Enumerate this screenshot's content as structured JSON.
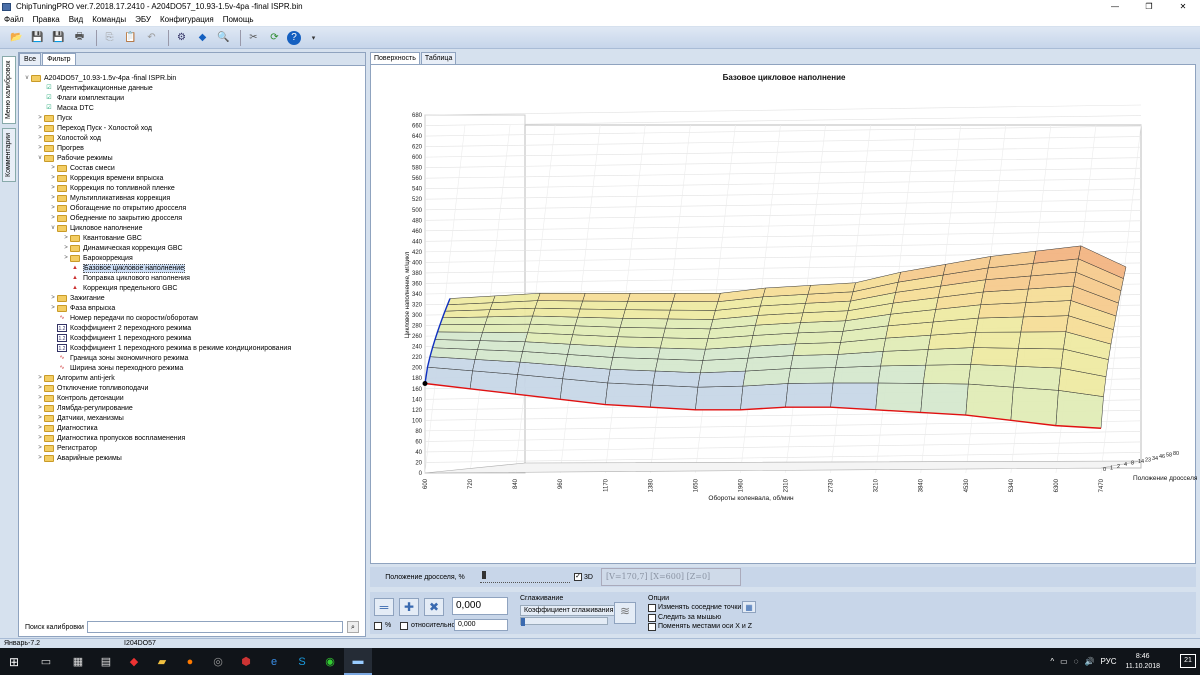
{
  "window": {
    "title": "ChipTuningPRO ver.7.2018.17.2410 - A204DO57_10.93-1.5v-4pa -final ISPR.bin",
    "min": "—",
    "max": "❐",
    "close": "✕"
  },
  "menu": [
    "Файл",
    "Правка",
    "Вид",
    "Команды",
    "ЭБУ",
    "Конфигурация",
    "Помощь"
  ],
  "side_tabs": {
    "calib": "Меню калибровок",
    "comments": "Комментарии"
  },
  "left": {
    "tabs": [
      "Все",
      "Фильтр"
    ],
    "tree": [
      {
        "label": "A204DO57_10.93-1.5v-4pa -final ISPR.bin",
        "level": 0,
        "icon": "folder",
        "toggle": "v"
      },
      {
        "label": "Идентификационные данные",
        "level": 1,
        "icon": "check",
        "toggle": ""
      },
      {
        "label": "Флаги комплектации",
        "level": 1,
        "icon": "check",
        "toggle": ""
      },
      {
        "label": "Маска DTC",
        "level": 1,
        "icon": "check",
        "toggle": ""
      },
      {
        "label": "Пуск",
        "level": 1,
        "icon": "folder",
        "toggle": ">"
      },
      {
        "label": "Переход Пуск - Холостой ход",
        "level": 1,
        "icon": "folder",
        "toggle": ">"
      },
      {
        "label": "Холостой ход",
        "level": 1,
        "icon": "folder",
        "toggle": ">"
      },
      {
        "label": "Прогрев",
        "level": 1,
        "icon": "folder",
        "toggle": ">"
      },
      {
        "label": "Рабочие режимы",
        "level": 1,
        "icon": "folder",
        "toggle": "v"
      },
      {
        "label": "Состав смеси",
        "level": 2,
        "icon": "folder",
        "toggle": ">"
      },
      {
        "label": "Коррекция времени впрыска",
        "level": 2,
        "icon": "folder",
        "toggle": ">"
      },
      {
        "label": "Коррекция по топливной пленке",
        "level": 2,
        "icon": "folder",
        "toggle": ">"
      },
      {
        "label": "Мультипликативная коррекция",
        "level": 2,
        "icon": "folder",
        "toggle": ">"
      },
      {
        "label": "Обогащение по открытию дросселя",
        "level": 2,
        "icon": "folder",
        "toggle": ">"
      },
      {
        "label": "Обеднение по закрытию дросселя",
        "level": 2,
        "icon": "folder",
        "toggle": ">"
      },
      {
        "label": "Цикловое наполнение",
        "level": 2,
        "icon": "folder",
        "toggle": "v"
      },
      {
        "label": "Квантование GBC",
        "level": 3,
        "icon": "folder",
        "toggle": ">"
      },
      {
        "label": "Динамическая коррекция GBC",
        "level": 3,
        "icon": "folder",
        "toggle": ">"
      },
      {
        "label": "Барокоррекция",
        "level": 3,
        "icon": "folder",
        "toggle": ">"
      },
      {
        "label": "Базовое цикловое наполнение",
        "level": 3,
        "icon": "graph",
        "toggle": "",
        "selected": true
      },
      {
        "label": "Поправка циклового наполнения",
        "level": 3,
        "icon": "graph",
        "toggle": ""
      },
      {
        "label": "Коррекция предельного GBC",
        "level": 3,
        "icon": "graph",
        "toggle": ""
      },
      {
        "label": "Зажигание",
        "level": 2,
        "icon": "folder",
        "toggle": ">"
      },
      {
        "label": "Фаза впрыска",
        "level": 2,
        "icon": "folder",
        "toggle": ">"
      },
      {
        "label": "Номер передачи по скорости/оборотам",
        "level": 2,
        "icon": "wave",
        "toggle": ""
      },
      {
        "label": "Коэффициент 2 переходного режима",
        "level": 2,
        "icon": "label",
        "toggle": ""
      },
      {
        "label": "Коэффициент 1 переходного режима",
        "level": 2,
        "icon": "label",
        "toggle": ""
      },
      {
        "label": "Коэффициент 1 переходного режима в режиме кондиционирования",
        "level": 2,
        "icon": "label",
        "toggle": ""
      },
      {
        "label": "Граница зоны экономичного режима",
        "level": 2,
        "icon": "wave",
        "toggle": ""
      },
      {
        "label": "Ширина зоны переходного режима",
        "level": 2,
        "icon": "wave",
        "toggle": ""
      },
      {
        "label": "Алгоритм anti-jerk",
        "level": 1,
        "icon": "folder",
        "toggle": ">"
      },
      {
        "label": "Отключение топливоподачи",
        "level": 1,
        "icon": "folder",
        "toggle": ">"
      },
      {
        "label": "Контроль детонации",
        "level": 1,
        "icon": "folder",
        "toggle": ">"
      },
      {
        "label": "Лямбда-регулирование",
        "level": 1,
        "icon": "folder",
        "toggle": ">"
      },
      {
        "label": "Датчики, механизмы",
        "level": 1,
        "icon": "folder",
        "toggle": ">"
      },
      {
        "label": "Диагностика",
        "level": 1,
        "icon": "folder",
        "toggle": ">"
      },
      {
        "label": "Диагностика пропусков воспламенения",
        "level": 1,
        "icon": "folder",
        "toggle": ">"
      },
      {
        "label": "Регистратор",
        "level": 1,
        "icon": "folder",
        "toggle": ">"
      },
      {
        "label": "Аварийные режимы",
        "level": 1,
        "icon": "folder",
        "toggle": ">"
      }
    ],
    "search_label": "Поиск калибровки",
    "search_value": ""
  },
  "right_tabs": [
    "Поверхность",
    "Таблица"
  ],
  "chart_data": {
    "type": "surface",
    "title": "Базовое цикловое наполнение",
    "xlabel": "Обороты коленвала, об/мин",
    "ylabel": "Положение дросселя, %",
    "zlabel": "Цикловое наполнение, мг/цикл",
    "x": [
      600,
      720,
      840,
      960,
      1170,
      1380,
      1650,
      1960,
      2310,
      2730,
      3210,
      3840,
      4530,
      5340,
      6300,
      7470
    ],
    "y_ticks": [
      "0",
      "1",
      "2",
      "4",
      "8",
      "14",
      "23",
      "34",
      "46",
      "58",
      "80"
    ],
    "zlim": [
      0,
      680
    ],
    "z_ticks": [
      0,
      20,
      40,
      60,
      80,
      100,
      120,
      140,
      160,
      180,
      200,
      220,
      240,
      260,
      280,
      300,
      320,
      340,
      360,
      380,
      400,
      420,
      440,
      460,
      480,
      500,
      520,
      540,
      560,
      580,
      600,
      620,
      640,
      660,
      680
    ],
    "series": [
      {
        "values": [
          170,
          160,
          150,
          140,
          130,
          125,
          120,
          120,
          125,
          125,
          120,
          115,
          110,
          100,
          90,
          85
        ]
      },
      {
        "values": [
          320,
          325,
          330,
          330,
          330,
          330,
          330,
          340,
          345,
          350,
          370,
          385,
          400,
          410,
          420,
          380
        ]
      }
    ]
  },
  "controls": {
    "throttle_label": "Положение дросселя, %",
    "d3_label": "3D",
    "d3_checked": "✓",
    "coord_text": "[V=170,7] [X=600] [Z=0]",
    "value1": "0,000",
    "value2": "0,000",
    "pct_label": "%",
    "relative_label": "относительно",
    "smoothing_group": "Сглаживание",
    "smoothing_coef": "Коэффициент сглаживания",
    "options_group": "Опции",
    "opt1": "Изменять соседние точки",
    "opt2": "Следить за мышью",
    "opt3": "Поменять местами оси X и Z"
  },
  "status": {
    "left": "Январь-7.2",
    "right": "I204DO57"
  },
  "taskbar": {
    "lang": "РУС",
    "time": "8:46",
    "date": "11.10.2018",
    "notify_count": "21"
  }
}
